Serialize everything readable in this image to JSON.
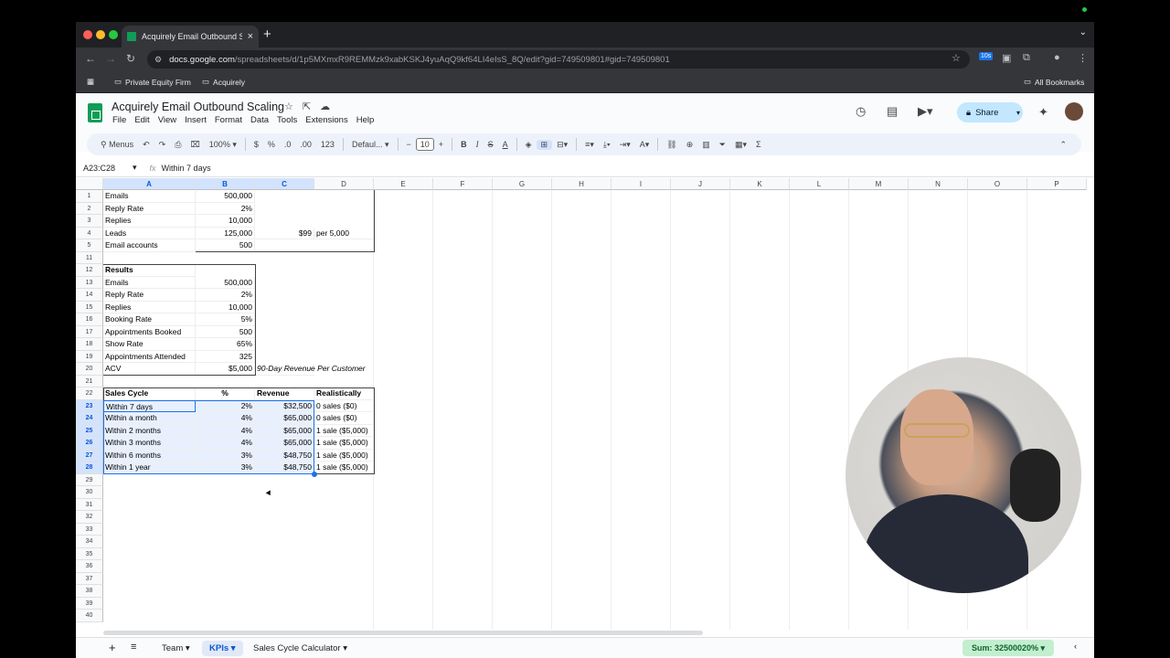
{
  "browser": {
    "tab_title": "Acquirely Email Outbound Sc",
    "url_host": "docs.google.com",
    "url_path": "/spreadsheets/d/1p5MXmxR9REMMzk9xabKSKJ4yuAqQ9kf64LI4eIsS_8Q/edit?gid=749509801#gid=749509801",
    "ext_badge": "10s",
    "bookmarks": [
      "Private Equity Firm",
      "Acquirely"
    ],
    "all_bookmarks": "All Bookmarks"
  },
  "sheets": {
    "title": "Acquirely Email Outbound Scaling",
    "menu": [
      "File",
      "Edit",
      "View",
      "Insert",
      "Format",
      "Data",
      "Tools",
      "Extensions",
      "Help"
    ],
    "share": "Share",
    "toolbar": {
      "menus": "Menus",
      "zoom": "100%",
      "dollar": "$",
      "percent": "%",
      "dec_minus": ".0",
      "dec_plus": ".00",
      "num": "123",
      "font": "Defaul...",
      "font_size": "10"
    },
    "namebox": "A23:C28",
    "formula": "Within 7 days",
    "fx": "fx"
  },
  "columns": [
    "A",
    "B",
    "C",
    "D",
    "E",
    "F",
    "G",
    "H",
    "I",
    "J",
    "K",
    "L",
    "M",
    "N",
    "O",
    "P"
  ],
  "rows": {
    "r1": {
      "n": "1",
      "a": "Emails",
      "b": "500,000"
    },
    "r2": {
      "n": "2",
      "a": "Reply Rate",
      "b": "2%"
    },
    "r3": {
      "n": "3",
      "a": "Replies",
      "b": "10,000"
    },
    "r4": {
      "n": "4",
      "a": "Leads",
      "b": "125,000",
      "c": "$99",
      "d": "per 5,000"
    },
    "r5": {
      "n": "5",
      "a": "Email accounts",
      "b": "500"
    },
    "r11": {
      "n": "11"
    },
    "r12": {
      "n": "12",
      "a": "Results"
    },
    "r13": {
      "n": "13",
      "a": "Emails",
      "b": "500,000"
    },
    "r14": {
      "n": "14",
      "a": "Reply Rate",
      "b": "2%"
    },
    "r15": {
      "n": "15",
      "a": "Replies",
      "b": "10,000"
    },
    "r16": {
      "n": "16",
      "a": "Booking Rate",
      "b": "5%"
    },
    "r17": {
      "n": "17",
      "a": "Appointments Booked",
      "b": "500"
    },
    "r18": {
      "n": "18",
      "a": "Show Rate",
      "b": "65%"
    },
    "r19": {
      "n": "19",
      "a": "Appointments Attended",
      "b": "325"
    },
    "r20": {
      "n": "20",
      "a": "ACV",
      "b": "$5,000",
      "c": "90-Day Revenue Per Customer"
    },
    "r21": {
      "n": "21"
    },
    "r22": {
      "n": "22",
      "a": "Sales Cycle",
      "b": "%",
      "c": "Revenue",
      "d": "Realistically"
    },
    "r23": {
      "n": "23",
      "a": "Within 7 days",
      "b": "2%",
      "c": "$32,500",
      "d": "0 sales ($0)"
    },
    "r24": {
      "n": "24",
      "a": "Within a month",
      "b": "4%",
      "c": "$65,000",
      "d": "0 sales ($0)"
    },
    "r25": {
      "n": "25",
      "a": "Within 2 months",
      "b": "4%",
      "c": "$65,000",
      "d": "1 sale ($5,000)"
    },
    "r26": {
      "n": "26",
      "a": "Within 3 months",
      "b": "4%",
      "c": "$65,000",
      "d": "1 sale ($5,000)"
    },
    "r27": {
      "n": "27",
      "a": "Within 6 months",
      "b": "3%",
      "c": "$48,750",
      "d": "1 sale ($5,000)"
    },
    "r28": {
      "n": "28",
      "a": "Within 1 year",
      "b": "3%",
      "c": "$48,750",
      "d": "1 sale ($5,000)"
    },
    "empty": [
      "29",
      "30",
      "31",
      "32",
      "33",
      "34",
      "35",
      "36",
      "37",
      "38",
      "39",
      "40"
    ]
  },
  "sheet_tabs": [
    "Team",
    "KPIs",
    "Sales Cycle Calculator"
  ],
  "sum": "Sum: 32500020%"
}
